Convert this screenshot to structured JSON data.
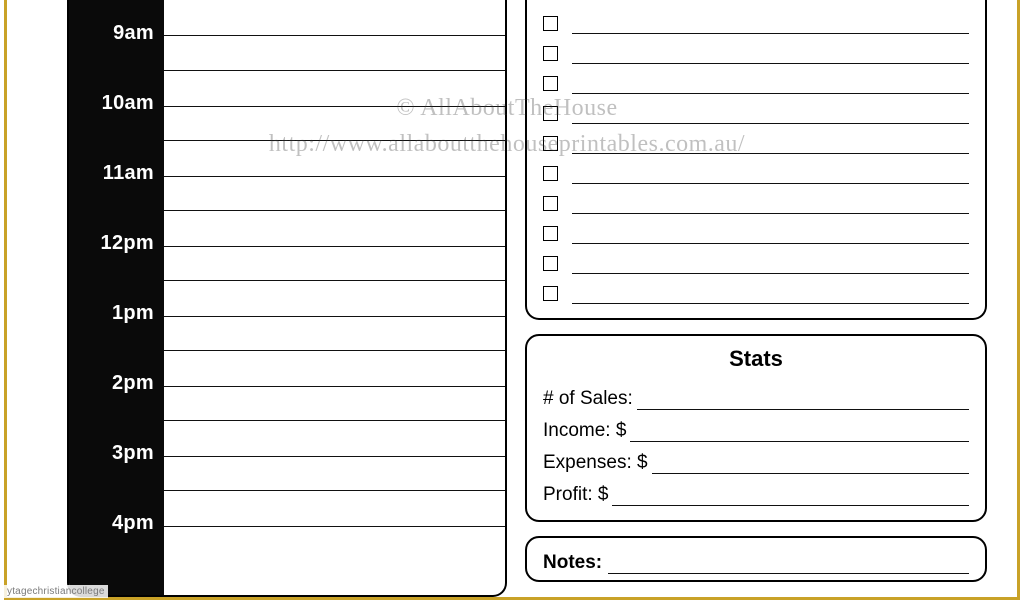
{
  "schedule": {
    "times": [
      "9am",
      "10am",
      "11am",
      "12pm",
      "1pm",
      "2pm",
      "3pm",
      "4pm"
    ]
  },
  "checklist": {
    "rows": 10
  },
  "stats": {
    "title": "Stats",
    "lines": [
      "# of Sales:",
      "Income: $",
      "Expenses: $",
      "Profit: $"
    ]
  },
  "notes": {
    "title": "Notes:"
  },
  "watermark": {
    "line1": "© AllAboutTheHouse",
    "line2": "http://www.allaboutthehouseprintables.com.au/"
  },
  "corner": "ytagechristiancollege"
}
